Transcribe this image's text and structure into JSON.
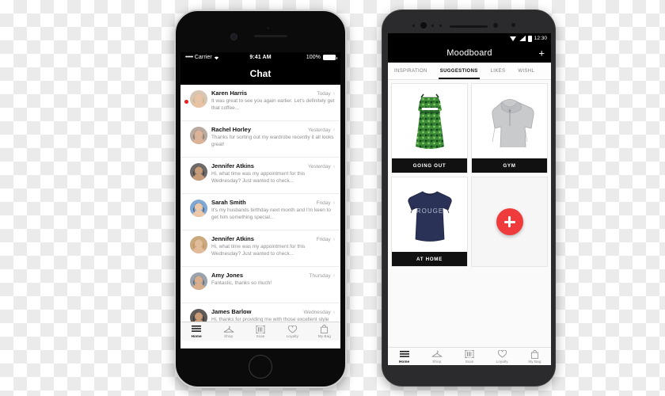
{
  "iphone": {
    "status": {
      "signal_dots": "•••••",
      "carrier": "Carrier",
      "wifi_icon": "wifi-icon",
      "time": "9:41 AM",
      "battery_pct": "100%"
    },
    "navbar": {
      "title": "Chat"
    },
    "conversations": [
      {
        "name": "Karen Harris",
        "when": "Today",
        "preview": "It was great to see you again earlier. Let's definitely get that coffee...",
        "unread": true,
        "avatar_color": "#d8c6b4"
      },
      {
        "name": "Rachel Horley",
        "when": "Yesterday",
        "preview": "Thanks for sorting out my wardrobe recently it all looks great!",
        "unread": false,
        "avatar_color": "#b9aaa0"
      },
      {
        "name": "Jennifer Atkins",
        "when": "Yesterday",
        "preview": "Hi, what time was my appointment for this Wednesday? Just wanted to check...",
        "unread": false,
        "avatar_color": "#6e6a6a"
      },
      {
        "name": "Sarah Smith",
        "when": "Friday",
        "preview": "It's my husbands birthday next month and I'm keen to get him something special...",
        "unread": false,
        "avatar_color": "#7fa8d4"
      },
      {
        "name": "Jennifer Atkins",
        "when": "Friday",
        "preview": "Hi, what time was my appointment for this Wednesday? Just wanted to check...",
        "unread": false,
        "avatar_color": "#caa97f"
      },
      {
        "name": "Amy Jones",
        "when": "Thursday",
        "preview": "Fantastic, thanks so much!",
        "unread": false,
        "avatar_color": "#9aa3ae"
      },
      {
        "name": "James Barlow",
        "when": "Wednesday",
        "preview": "Hi, thanks for providing me with those excellent style tips! My wardrobe looks...",
        "unread": false,
        "avatar_color": "#5d5a58"
      }
    ],
    "tabbar": [
      {
        "label": "Home",
        "icon": "hamburger-menu-icon",
        "active": true
      },
      {
        "label": "Shop",
        "icon": "clothes-hanger-icon",
        "active": false
      },
      {
        "label": "Scan",
        "icon": "barcode-scan-icon",
        "active": false
      },
      {
        "label": "Loyalty",
        "icon": "heart-icon",
        "active": false
      },
      {
        "label": "My Bag",
        "icon": "shopping-bag-icon",
        "active": false
      }
    ]
  },
  "android": {
    "status": {
      "wifi_icon": "wifi-icon",
      "signal_icon": "cell-signal-icon",
      "battery_icon": "battery-icon",
      "time": "12:30"
    },
    "appbar": {
      "title": "Moodboard",
      "add_label": "+"
    },
    "tabs": [
      {
        "label": "INSPIRATION",
        "active": false
      },
      {
        "label": "SUGGESTIONS",
        "active": true
      },
      {
        "label": "LIKES",
        "active": false
      },
      {
        "label": "WISHL",
        "active": false
      }
    ],
    "cards": [
      {
        "label": "GOING OUT",
        "item": "green-floral-dress"
      },
      {
        "label": "GYM",
        "item": "grey-hoodie"
      },
      {
        "label": "AT HOME",
        "item": "navy-rouge-tshirt",
        "print_text": "ROUGE"
      }
    ],
    "fab": {
      "name": "add-moodboard-button",
      "color": "#ef3b3b",
      "glyph": "+"
    },
    "tabbar": [
      {
        "label": "Home",
        "icon": "hamburger-menu-icon",
        "active": true
      },
      {
        "label": "Shop",
        "icon": "clothes-hanger-icon",
        "active": false
      },
      {
        "label": "Scan",
        "icon": "barcode-scan-icon",
        "active": false
      },
      {
        "label": "Loyalty",
        "icon": "heart-icon",
        "active": false
      },
      {
        "label": "My Bag",
        "icon": "shopping-bag-icon",
        "active": false
      }
    ]
  }
}
